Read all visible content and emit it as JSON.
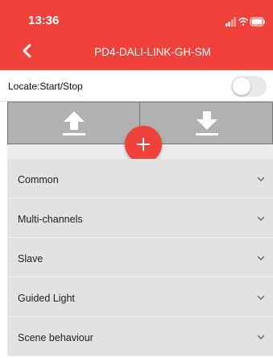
{
  "status": {
    "time": "13:36",
    "icons": [
      "signal-icon",
      "wifi-icon",
      "battery-icon"
    ]
  },
  "header": {
    "title": "PD4-DALI-LINK-GH-SM",
    "back_icon": "chevron-left-icon",
    "color": "#f0423a"
  },
  "locate": {
    "label": "Locate:Start/Stop",
    "toggle_on": false
  },
  "actions": {
    "upload_icon": "upload-arrow-icon",
    "download_icon": "download-arrow-icon",
    "add_icon": "plus-icon"
  },
  "sections": [
    {
      "label": "Common"
    },
    {
      "label": "Multi-channels"
    },
    {
      "label": "Slave"
    },
    {
      "label": "Guided Light"
    },
    {
      "label": "Scene behaviour"
    }
  ]
}
